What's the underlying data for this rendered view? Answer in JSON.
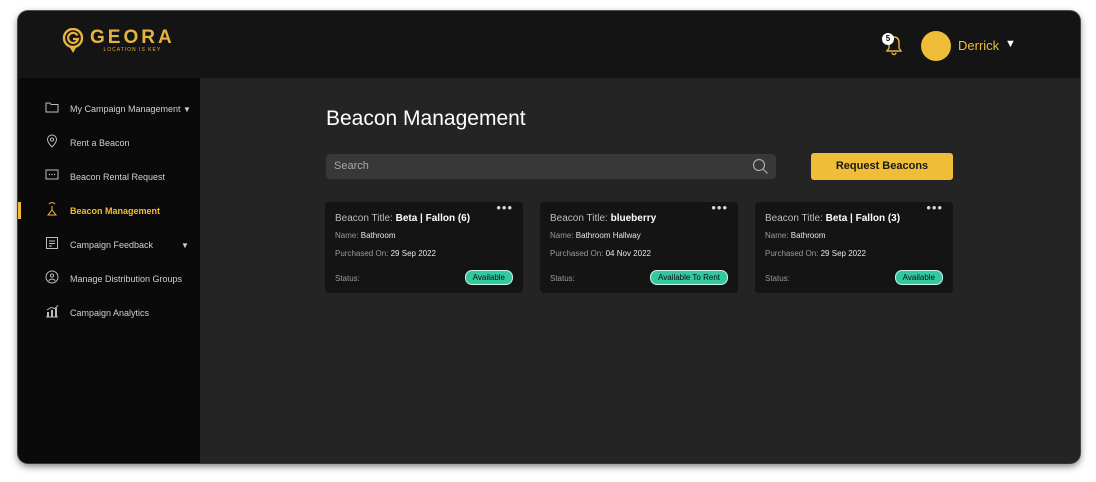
{
  "brand": {
    "name": "GEORA",
    "tagline": "LOCATION IS KEY",
    "accent": "#f0bd38"
  },
  "header": {
    "notification_count": "5",
    "username": "Derrick",
    "user_caret": "▼"
  },
  "sidebar": {
    "items": [
      {
        "label": "My Campaign Management",
        "icon": "folder-icon",
        "caret": "▼"
      },
      {
        "label": "Rent a Beacon",
        "icon": "location-pin-icon"
      },
      {
        "label": "Beacon Rental Request",
        "icon": "chat-icon"
      },
      {
        "label": "Beacon Management",
        "icon": "beacon-icon"
      },
      {
        "label": "Campaign Feedback",
        "icon": "feedback-icon",
        "caret": "▼"
      },
      {
        "label": "Manage Distribution Groups",
        "icon": "group-icon"
      },
      {
        "label": "Campaign Analytics",
        "icon": "analytics-icon"
      }
    ],
    "active": "Beacon Management"
  },
  "main": {
    "title": "Beacon Management",
    "search": {
      "placeholder": "Search"
    },
    "request_button": "Request Beacons",
    "labels": {
      "beacon_title": "Beacon Title:",
      "name": "Name:",
      "purchased_on": "Purchased On:",
      "status": "Status:"
    },
    "more": "•••",
    "cards": [
      {
        "title": "Beta | Fallon (6)",
        "name": "Bathroom",
        "purchased_on": "29 Sep 2022",
        "status": "Available"
      },
      {
        "title": "blueberry",
        "name": "Bathroom Hallway",
        "purchased_on": "04 Nov 2022",
        "status": "Available To Rent"
      },
      {
        "title": "Beta | Fallon (3)",
        "name": "Bathroom",
        "purchased_on": "29 Sep 2022",
        "status": "Available"
      }
    ]
  }
}
